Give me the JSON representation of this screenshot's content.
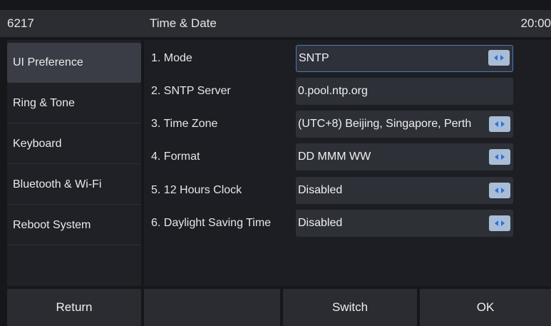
{
  "header": {
    "device": "6217",
    "title": "Time & Date",
    "time": "20:00"
  },
  "sidebar": {
    "items": [
      {
        "label": "UI Preference",
        "active": true
      },
      {
        "label": "Ring & Tone"
      },
      {
        "label": "Keyboard"
      },
      {
        "label": "Bluetooth & Wi-Fi"
      },
      {
        "label": "Reboot System"
      }
    ]
  },
  "settings": [
    {
      "label": "1. Mode",
      "value": "SNTP",
      "has_arrows": true,
      "focused": true
    },
    {
      "label": "2. SNTP Server",
      "value": "0.pool.ntp.org",
      "has_arrows": false
    },
    {
      "label": "3. Time Zone",
      "value": "(UTC+8) Beijing, Singapore, Perth",
      "has_arrows": true
    },
    {
      "label": "4. Format",
      "value": "DD MMM WW",
      "has_arrows": true
    },
    {
      "label": "5. 12 Hours Clock",
      "value": "Disabled",
      "has_arrows": true
    },
    {
      "label": "6. Daylight Saving Time",
      "value": "Disabled",
      "has_arrows": true
    }
  ],
  "softkeys": {
    "key1": "Return",
    "key2": "",
    "key3": "Switch",
    "key4": "OK"
  },
  "icons": {
    "arrow": "left-right-arrows-icon"
  },
  "colors": {
    "focus_border": "#4c79b8",
    "arrow_button": "#a9bdd7",
    "arrow_glyph": "#2f6fd6"
  }
}
